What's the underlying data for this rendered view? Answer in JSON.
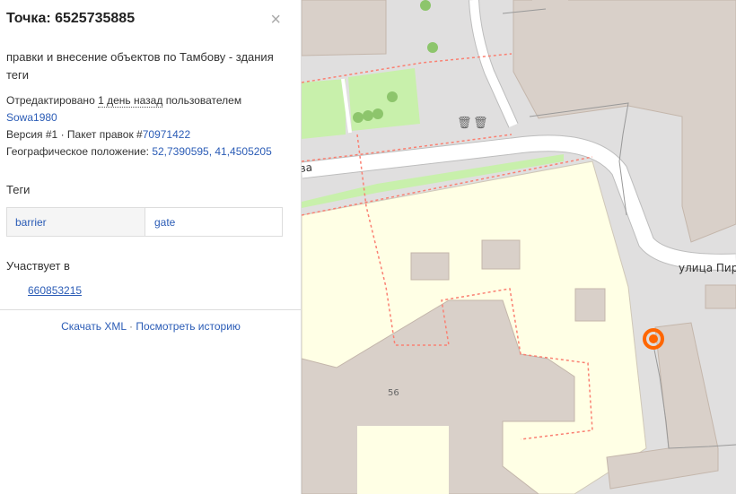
{
  "sidebar": {
    "title": "Точка: 6525735885",
    "close_glyph": "×",
    "comment": "правки и внесение объектов по Тамбову - здания теги",
    "edited_prefix": "Отредактировано",
    "edited_time": "1 день назад",
    "edited_by_prefix": "пользователем",
    "user": "Sowa1980",
    "version_label": "Версия #1",
    "sep": "·",
    "changeset_prefix": "Пакет правок #",
    "changeset_id": "70971422",
    "location_label": "Географическое положение:",
    "location_value": "52,7390595, 41,4505205",
    "tags_heading": "Теги",
    "tags": [
      {
        "key": "barrier",
        "value": "gate"
      }
    ],
    "part_of_heading": "Участвует в",
    "relation_id": "660853215",
    "download_xml": "Скачать XML",
    "view_history": "Посмотреть историю"
  },
  "map": {
    "street_top": "ва",
    "street_right": "улица Пиро",
    "house_number": "56",
    "colors": {
      "background": "#e0dfdf",
      "building": "#d9d0c9",
      "school_area": "#ffffe5",
      "park": "#c8f0ab",
      "road": "#ffffff",
      "path_red": "#fa8072",
      "selected_marker": "#ff6600"
    }
  }
}
